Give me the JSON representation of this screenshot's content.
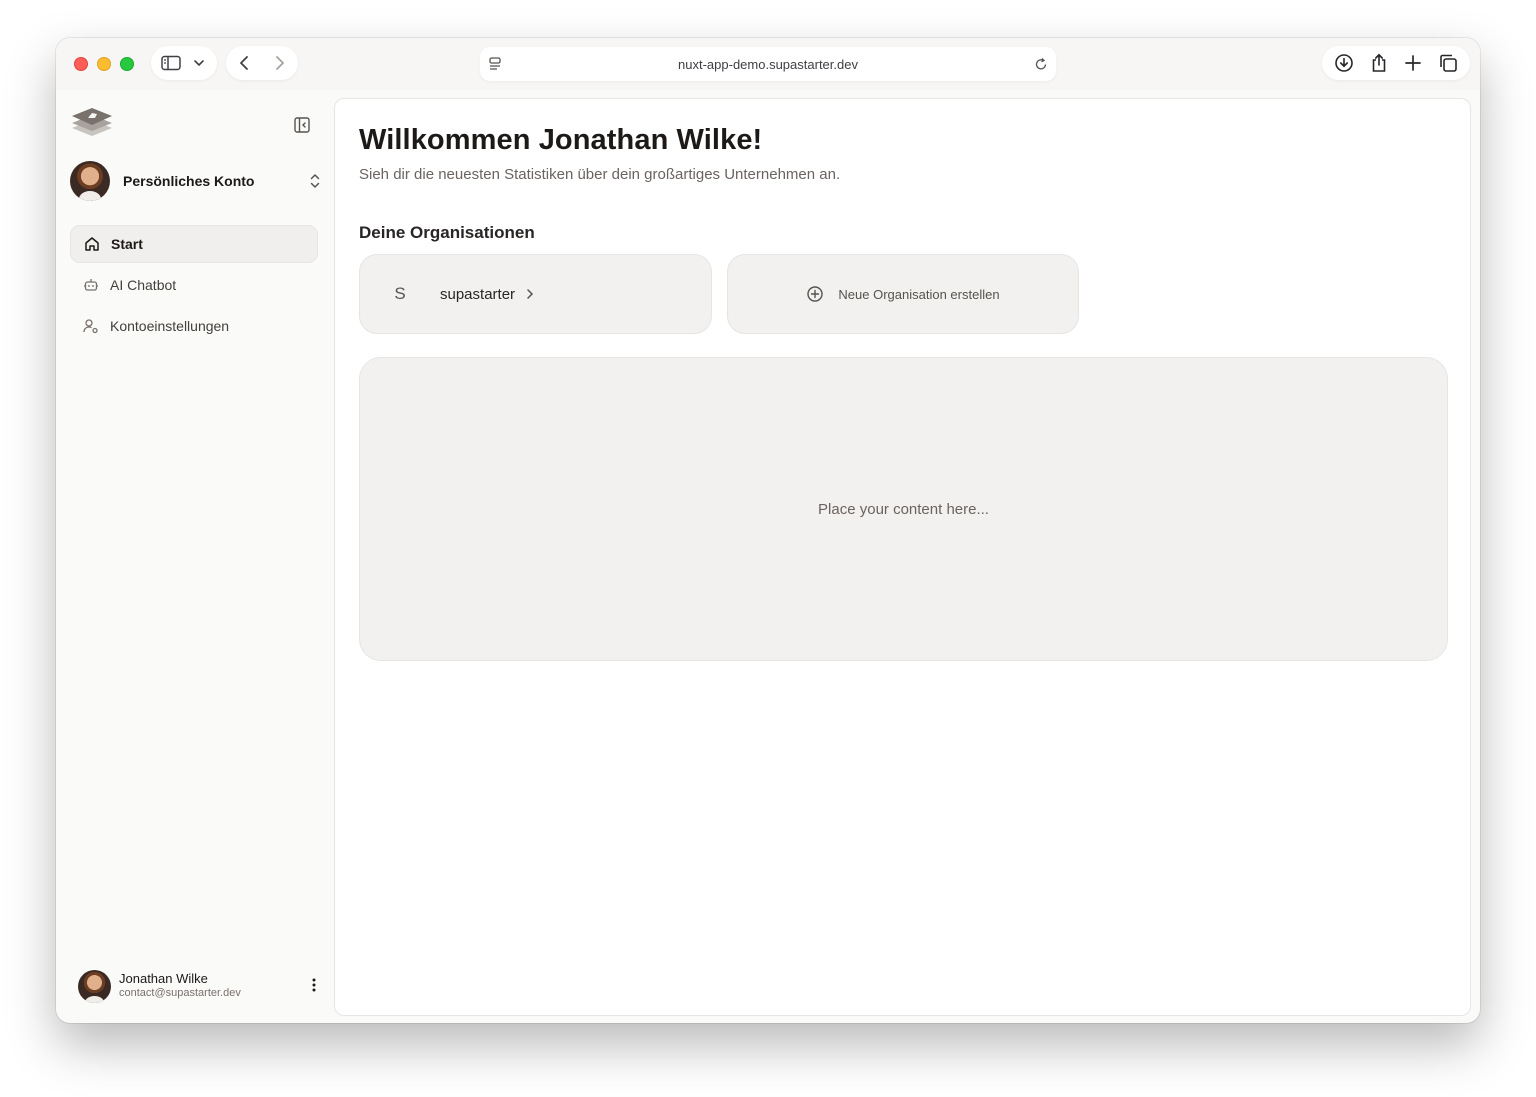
{
  "browser": {
    "url": "nuxt-app-demo.supastarter.dev"
  },
  "sidebar": {
    "account_label": "Persönliches Konto",
    "items": [
      {
        "label": "Start",
        "icon": "home-icon",
        "active": true
      },
      {
        "label": "AI Chatbot",
        "icon": "bot-icon",
        "active": false
      },
      {
        "label": "Kontoeinstellungen",
        "icon": "user-cog-icon",
        "active": false
      }
    ],
    "user": {
      "name": "Jonathan Wilke",
      "email": "contact@supastarter.dev"
    }
  },
  "main": {
    "title": "Willkommen Jonathan Wilke!",
    "subtitle": "Sieh dir die neuesten Statistiken über dein großartiges Unternehmen an.",
    "organizations_heading": "Deine Organisationen",
    "organizations": [
      {
        "initial": "S",
        "name": "supastarter"
      }
    ],
    "new_org_label": "Neue Organisation erstellen",
    "placeholder": "Place your content here..."
  }
}
